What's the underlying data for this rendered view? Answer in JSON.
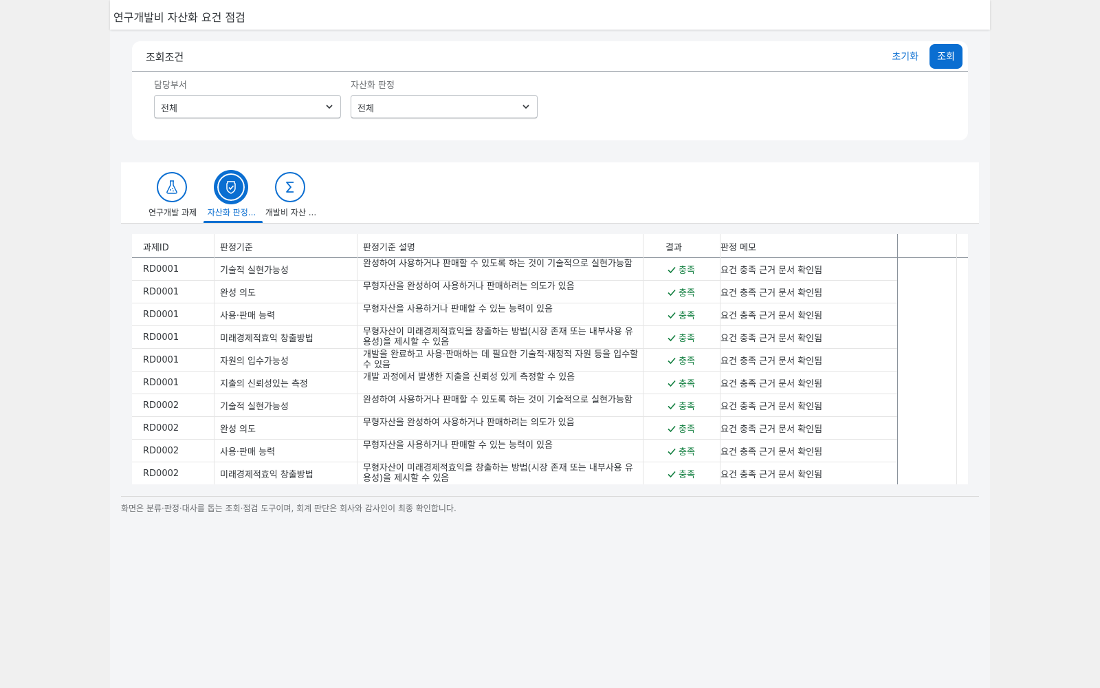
{
  "app": {
    "title": "연구개발비 자산화 요건 점검"
  },
  "filter": {
    "title": "조회조건",
    "reset_label": "초기화",
    "search_label": "조회",
    "department": {
      "label": "담당부서",
      "value": "전체"
    },
    "judgement": {
      "label": "자산화 판정",
      "value": "전체"
    }
  },
  "tabs": [
    {
      "label": "연구개발 과제",
      "icon": "flask-icon",
      "active": false
    },
    {
      "label": "자산화 판정...",
      "icon": "shield-check-icon",
      "active": true
    },
    {
      "label": "개발비 자산 ...",
      "icon": "sigma-icon",
      "active": false
    }
  ],
  "table": {
    "headers": [
      "과제ID",
      "판정기준",
      "판정기준 설명",
      "결과",
      "판정 메모"
    ],
    "rows": [
      {
        "id": "RD0001",
        "criterion": "기술적 실현가능성",
        "description": "완성하여 사용하거나 판매할 수 있도록 하는 것이 기술적으로 실현가능함",
        "result": "충족",
        "memo": "요건 충족 근거 문서 확인됨"
      },
      {
        "id": "RD0001",
        "criterion": "완성 의도",
        "description": "무형자산을 완성하여 사용하거나 판매하려는 의도가 있음",
        "result": "충족",
        "memo": "요건 충족 근거 문서 확인됨"
      },
      {
        "id": "RD0001",
        "criterion": "사용·판매 능력",
        "description": "무형자산을 사용하거나 판매할 수 있는 능력이 있음",
        "result": "충족",
        "memo": "요건 충족 근거 문서 확인됨"
      },
      {
        "id": "RD0001",
        "criterion": "미래경제적효익 창출방법",
        "description": "무형자산이 미래경제적효익을 창출하는 방법(시장 존재 또는 내부사용 유용성)을 제시할 수 있음",
        "result": "충족",
        "memo": "요건 충족 근거 문서 확인됨"
      },
      {
        "id": "RD0001",
        "criterion": "자원의 입수가능성",
        "description": "개발을 완료하고 사용·판매하는 데 필요한 기술적·재정적 자원 등을 입수할 수 있음",
        "result": "충족",
        "memo": "요건 충족 근거 문서 확인됨"
      },
      {
        "id": "RD0001",
        "criterion": "지출의 신뢰성있는 측정",
        "description": "개발 과정에서 발생한 지출을 신뢰성 있게 측정할 수 있음",
        "result": "충족",
        "memo": "요건 충족 근거 문서 확인됨"
      },
      {
        "id": "RD0002",
        "criterion": "기술적 실현가능성",
        "description": "완성하여 사용하거나 판매할 수 있도록 하는 것이 기술적으로 실현가능함",
        "result": "충족",
        "memo": "요건 충족 근거 문서 확인됨"
      },
      {
        "id": "RD0002",
        "criterion": "완성 의도",
        "description": "무형자산을 완성하여 사용하거나 판매하려는 의도가 있음",
        "result": "충족",
        "memo": "요건 충족 근거 문서 확인됨"
      },
      {
        "id": "RD0002",
        "criterion": "사용·판매 능력",
        "description": "무형자산을 사용하거나 판매할 수 있는 능력이 있음",
        "result": "충족",
        "memo": "요건 충족 근거 문서 확인됨"
      },
      {
        "id": "RD0002",
        "criterion": "미래경제적효익 창출방법",
        "description": "무형자산이 미래경제적효익을 창출하는 방법(시장 존재 또는 내부사용 유용성)을 제시할 수 있음",
        "result": "충족",
        "memo": "요건 충족 근거 문서 확인됨"
      }
    ]
  },
  "footer": {
    "note": "화면은 분류·판정·대사를 돕는 조회·점검 도구이며, 회계 판단은 회사와 감사인이 최종 확인합니다."
  },
  "colors": {
    "accent": "#0a6ed1",
    "success": "#107e3e"
  }
}
